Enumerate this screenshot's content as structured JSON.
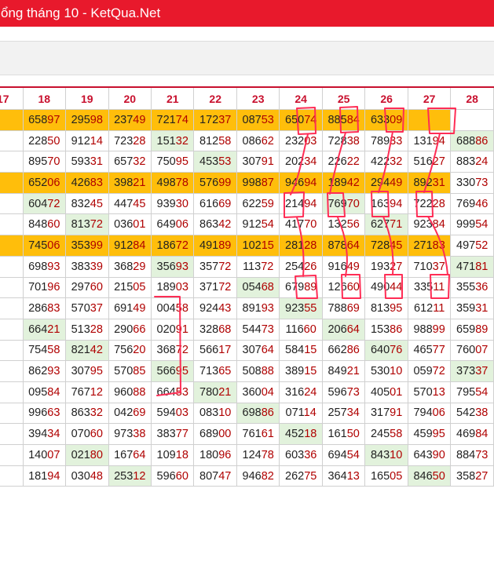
{
  "header": {
    "title": "ổng tháng 10 - KetQua.Net"
  },
  "table": {
    "columns": [
      "17",
      "18",
      "19",
      "20",
      "21",
      "22",
      "23",
      "24",
      "25",
      "26",
      "27",
      "28"
    ],
    "rows": [
      {
        "highlight": true,
        "cells": [
          "",
          "65897",
          "29598",
          "23749",
          "72174",
          "17237",
          "08753",
          "65074",
          "88584",
          "63309",
          "",
          ""
        ]
      },
      {
        "highlight": false,
        "cells": [
          "",
          "22850",
          "91214",
          "72328",
          "15132",
          "81258",
          "08662",
          "23203",
          "72838",
          "78933",
          "13194",
          "68886"
        ],
        "green": [
          4,
          11
        ]
      },
      {
        "highlight": false,
        "cells": [
          "",
          "89570",
          "59331",
          "65732",
          "75095",
          "45353",
          "30791",
          "20234",
          "22622",
          "42232",
          "51627",
          "88324"
        ],
        "green": [
          5
        ]
      },
      {
        "highlight": true,
        "cells": [
          "",
          "65206",
          "42683",
          "39821",
          "49878",
          "57699",
          "99887",
          "94694",
          "18942",
          "29449",
          "89231",
          "33073"
        ],
        "green": [
          6
        ],
        "plainEnd": [
          11
        ]
      },
      {
        "highlight": false,
        "cells": [
          "",
          "60472",
          "83245",
          "44745",
          "93930",
          "61669",
          "62259",
          "21494",
          "76970",
          "16394",
          "72228",
          "76946"
        ],
        "green": [
          1,
          8
        ]
      },
      {
        "highlight": false,
        "cells": [
          "",
          "84860",
          "81372",
          "03601",
          "64906",
          "86342",
          "91254",
          "41770",
          "13256",
          "62771",
          "92384",
          "99954"
        ],
        "green": [
          2,
          9
        ]
      },
      {
        "highlight": true,
        "cells": [
          "",
          "74506",
          "35399",
          "91284",
          "18672",
          "49189",
          "10215",
          "28128",
          "87864",
          "72845",
          "27183",
          "49752"
        ],
        "plainEnd": [
          11
        ]
      },
      {
        "highlight": false,
        "cells": [
          "",
          "69893",
          "38339",
          "36829",
          "35693",
          "35772",
          "11372",
          "25426",
          "91649",
          "19327",
          "71037",
          "47181"
        ],
        "green": [
          4,
          11
        ]
      },
      {
        "highlight": false,
        "cells": [
          "",
          "70196",
          "29760",
          "21505",
          "18903",
          "37172",
          "05468",
          "67989",
          "12660",
          "49044",
          "33511",
          "35536"
        ],
        "green": [
          6
        ]
      },
      {
        "highlight": false,
        "cells": [
          "",
          "28683",
          "57037",
          "69149",
          "00458",
          "92443",
          "89193",
          "92355",
          "78869",
          "81395",
          "61211",
          "35931"
        ],
        "green": [
          7
        ]
      },
      {
        "highlight": false,
        "cells": [
          "",
          "66421",
          "51328",
          "29066",
          "02091",
          "32868",
          "54473",
          "11660",
          "20664",
          "15386",
          "98899",
          "65989"
        ],
        "green": [
          1,
          8
        ]
      },
      {
        "highlight": false,
        "cells": [
          "",
          "75458",
          "82142",
          "75620",
          "36872",
          "56617",
          "30764",
          "58415",
          "66286",
          "64076",
          "46577",
          "76007"
        ],
        "green": [
          2,
          9
        ]
      },
      {
        "highlight": false,
        "cells": [
          "",
          "86293",
          "30795",
          "57085",
          "56695",
          "71365",
          "50888",
          "38915",
          "84921",
          "53010",
          "05972",
          "37337"
        ],
        "green": [
          4,
          11
        ]
      },
      {
        "highlight": false,
        "cells": [
          "",
          "09584",
          "76712",
          "96088",
          "66453",
          "78021",
          "36004",
          "31624",
          "59673",
          "40501",
          "57013",
          "79554"
        ],
        "green": [
          5
        ]
      },
      {
        "highlight": false,
        "cells": [
          "",
          "99663",
          "86332",
          "04269",
          "59403",
          "08310",
          "69886",
          "07114",
          "25734",
          "31791",
          "79406",
          "54238"
        ],
        "green": [
          6
        ]
      },
      {
        "highlight": false,
        "cells": [
          "",
          "39434",
          "07060",
          "97338",
          "38377",
          "68900",
          "76161",
          "45218",
          "16150",
          "24558",
          "45995",
          "46984"
        ],
        "green": [
          7
        ]
      },
      {
        "highlight": false,
        "cells": [
          "",
          "14007",
          "02180",
          "16764",
          "10918",
          "18096",
          "12478",
          "60336",
          "69454",
          "84310",
          "64390",
          "88473"
        ],
        "green": [
          2,
          9
        ]
      },
      {
        "highlight": false,
        "cells": [
          "",
          "18194",
          "03048",
          "25312",
          "59660",
          "80747",
          "94682",
          "26275",
          "36413",
          "16505",
          "84650",
          "35827"
        ],
        "green": [
          3,
          10
        ]
      }
    ]
  },
  "colors": {
    "titlebar": "#e8192c",
    "highlight": "#ffbe0b",
    "match": "#e2f2dc",
    "tail": "#b00000",
    "annotation": "#ff2d55"
  }
}
